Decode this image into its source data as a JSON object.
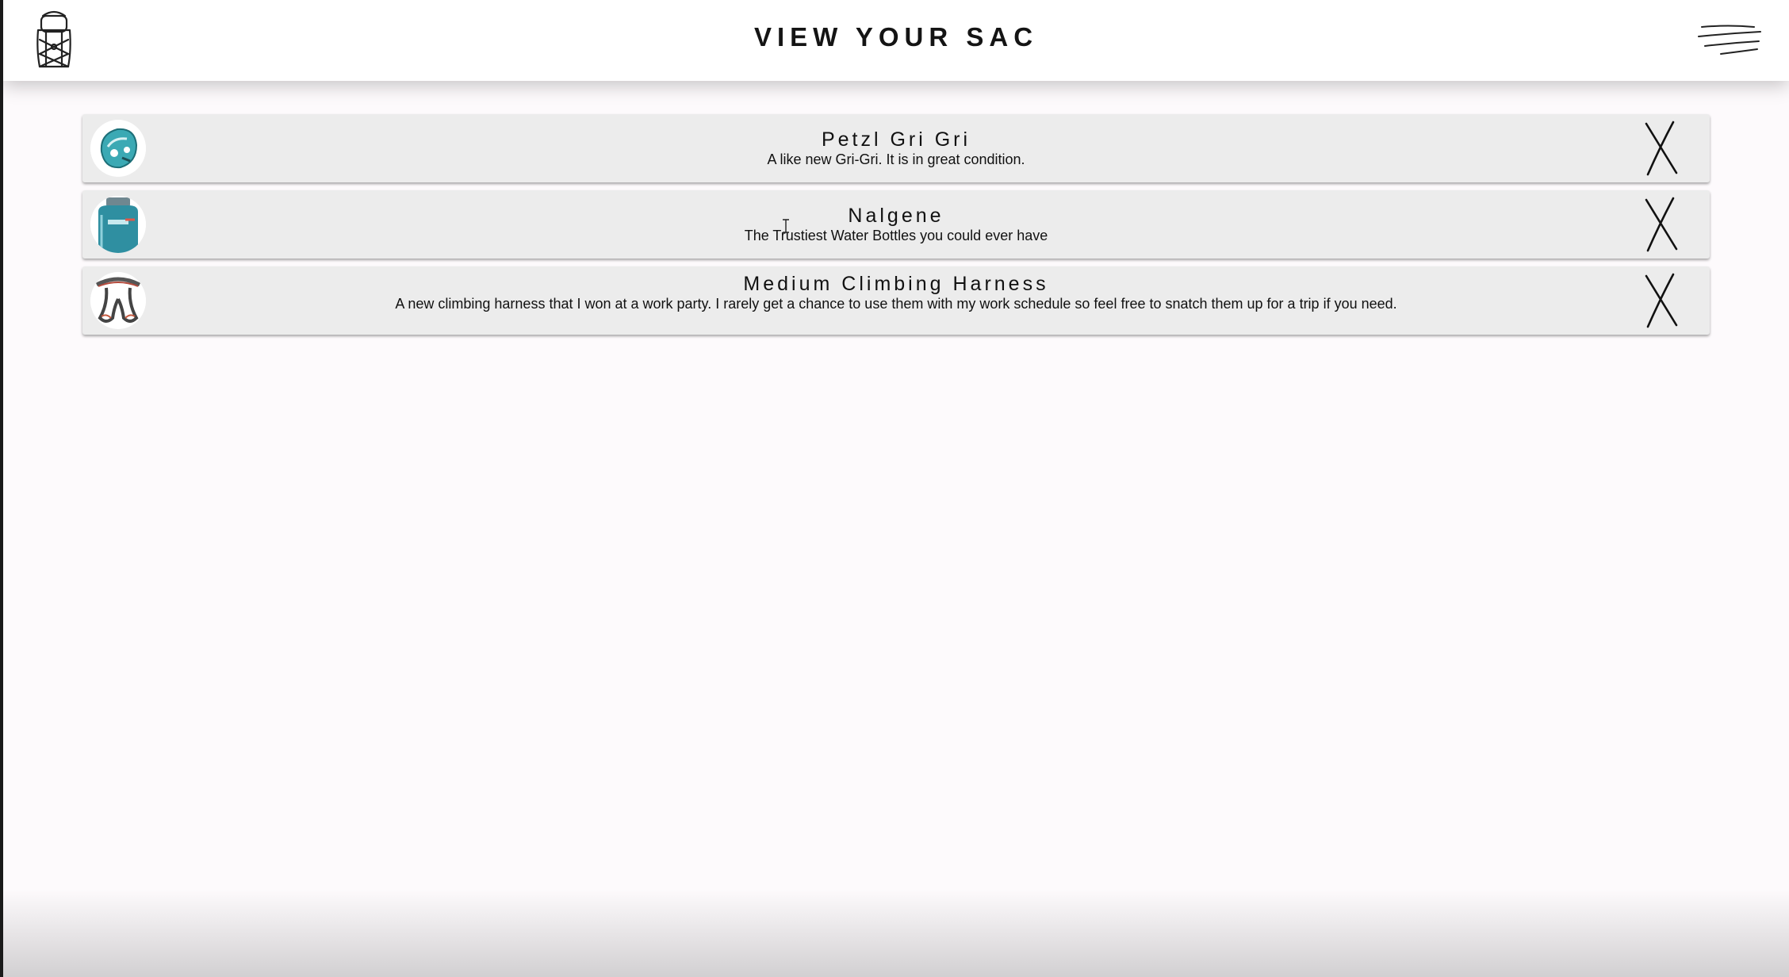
{
  "header": {
    "title": "VIEW YOUR SAC",
    "logo_icon": "backpack-icon",
    "menu_icon": "hamburger-menu-icon"
  },
  "items": [
    {
      "name": "Petzl Gri Gri",
      "description": "A like new Gri-Gri. It is in great condition.",
      "thumbnail": "gri-gri-belay-device-image",
      "remove_icon": "x-remove-icon"
    },
    {
      "name": "Nalgene",
      "description": "The Trustiest Water Bottles you could ever have",
      "thumbnail": "water-bottle-image",
      "remove_icon": "x-remove-icon"
    },
    {
      "name": "Medium Climbing Harness",
      "description": "A new climbing harness that I won at a work party. I rarely get a chance to use them with my work schedule so feel free to snatch them up for a trip if you need.",
      "thumbnail": "climbing-harness-image",
      "remove_icon": "x-remove-icon"
    }
  ],
  "colors": {
    "background": "#fdfafc",
    "header": "#ffffff",
    "item_background": "#ececec",
    "accent_teal": "#3ba9b4"
  }
}
